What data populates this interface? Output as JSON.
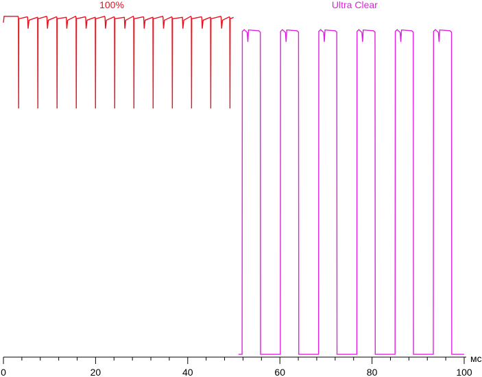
{
  "chart_data": {
    "type": "line",
    "title": "",
    "xlabel": "",
    "ylabel": "",
    "x_unit": "мс",
    "xlim": [
      0,
      100
    ],
    "ylim": [
      0,
      100
    ],
    "x_ticks": [
      0,
      20,
      40,
      60,
      80,
      100
    ],
    "x_minor_step": 4,
    "y_axis_visible": false,
    "grid": false,
    "legend": "none",
    "series": [
      {
        "name": "100%",
        "color": "#e8101c",
        "x_range": [
          0,
          50
        ],
        "baseline": 97,
        "pwm_period": 4.17,
        "first_dip": 3.3,
        "dip_level": 71,
        "small_notches": [
          5.3,
          9.5,
          13.7,
          17.9,
          22.1,
          26.3,
          30.5,
          34.7,
          38.9,
          43.1,
          47.3
        ]
      },
      {
        "name": "Ultra Clear",
        "color": "#e020e0",
        "x_range": [
          51,
          100
        ],
        "high_level": 93,
        "low_level": 0.8,
        "pulses": [
          {
            "on": 51.8,
            "off": 55.8
          },
          {
            "on": 60.1,
            "off": 64.1
          },
          {
            "on": 68.4,
            "off": 72.4
          },
          {
            "on": 76.7,
            "off": 80.7
          },
          {
            "on": 85.0,
            "off": 89.0
          },
          {
            "on": 93.3,
            "off": 97.3
          }
        ]
      }
    ]
  }
}
